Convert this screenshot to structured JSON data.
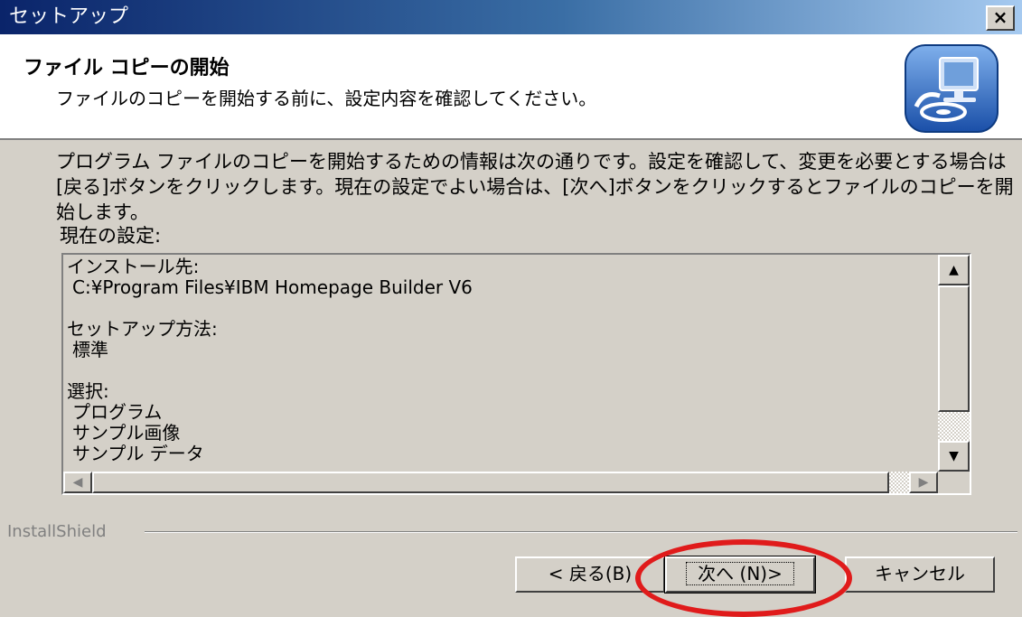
{
  "window": {
    "title": "セットアップ",
    "close_label": "×"
  },
  "header": {
    "title": "ファイル コピーの開始",
    "subtitle": "ファイルのコピーを開始する前に、設定内容を確認してください。",
    "icon": "setup-computer-icon"
  },
  "body": {
    "info": "プログラム ファイルのコピーを開始するための情報は次の通りです。設定を確認して、変更を必要とする場合は\n[戻る]ボタンをクリックします。現在の設定でよい場合は、[次へ]ボタンをクリックするとファイルのコピーを開始します。",
    "settings_label": "現在の設定:",
    "settings": {
      "install_dest_title": "インストール先:",
      "install_dest_value": "C:¥Program Files¥IBM Homepage Builder V6",
      "setup_type_title": "セットアップ方法:",
      "setup_type_value": "標準",
      "selection_title": "選択:",
      "selection_items": [
        "プログラム",
        "サンプル画像",
        "サンプル データ"
      ]
    }
  },
  "footer": {
    "brand": "InstallShield",
    "back_label": "< 戻る(B)",
    "next_label": "次へ (N)>",
    "cancel_label": "キャンセル"
  },
  "annotation": {
    "color": "#e01b1b"
  }
}
